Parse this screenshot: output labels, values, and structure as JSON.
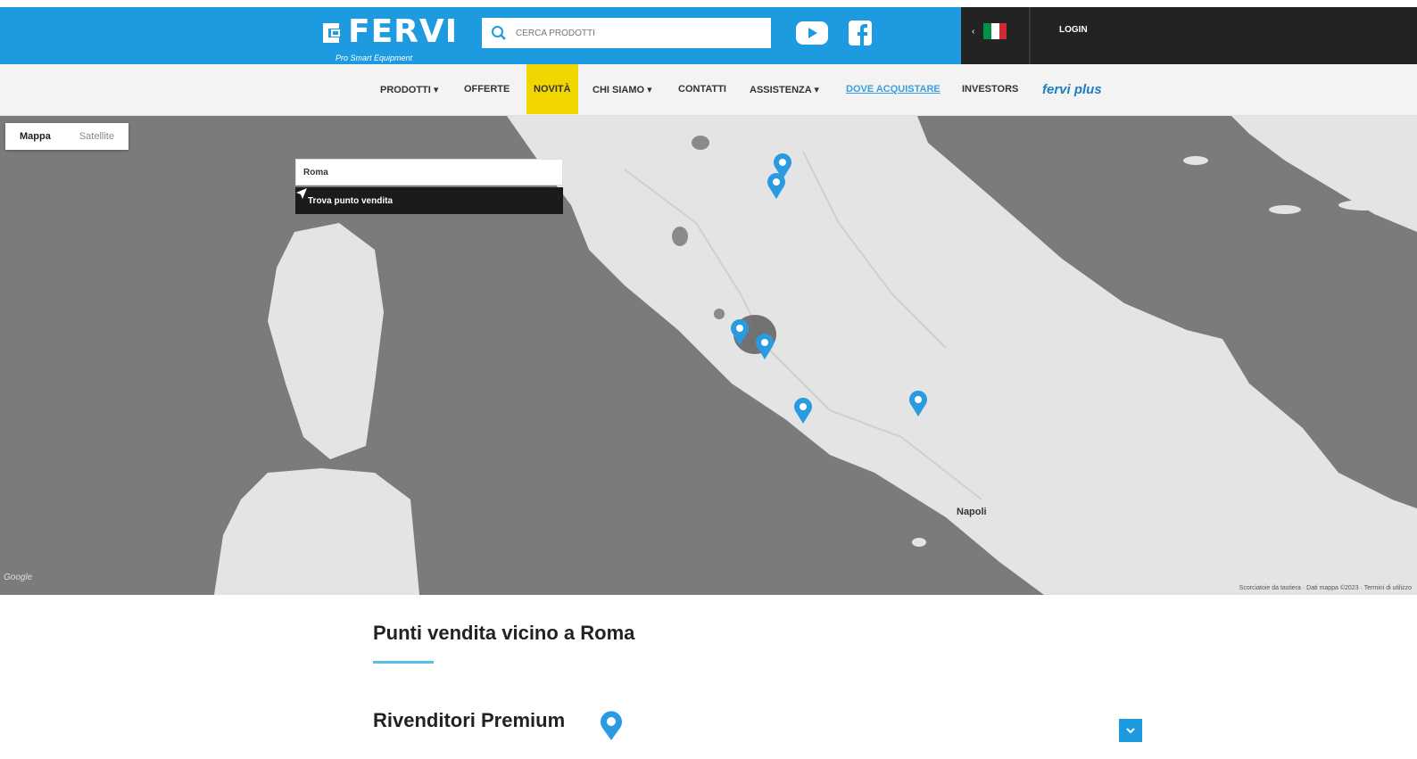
{
  "header": {
    "logo_text": "FERVI",
    "logo_tagline": "Pro Smart Equipment",
    "search_placeholder": "CERCA PRODOTTI",
    "login_label": "LOGIN"
  },
  "nav": {
    "items": [
      {
        "label": "PRODOTTI ▾"
      },
      {
        "label": "OFFERTE"
      },
      {
        "label": "NOVITÀ"
      },
      {
        "label": "CHI SIAMO ▾"
      },
      {
        "label": "CONTATTI"
      },
      {
        "label": "ASSISTENZA ▾"
      },
      {
        "label": "DOVE ACQUISTARE"
      },
      {
        "label": "INVESTORS"
      },
      {
        "label": "fervi plus"
      }
    ]
  },
  "map": {
    "type_map": "Mappa",
    "type_satellite": "Satellite",
    "location_value": "Roma",
    "find_button": "Trova punto vendita",
    "google_label": "Google",
    "attribution": "Scorciatoie da tastiera · Dati mappa ©2023 · Termini di utilizzo",
    "city_label": "Napoli"
  },
  "results": {
    "title": "Punti vendita vicino a Roma",
    "section_title": "Rivenditori Premium"
  },
  "colors": {
    "brand_blue": "#1e9ae0",
    "dark": "#232323",
    "highlight": "#f2d600"
  }
}
